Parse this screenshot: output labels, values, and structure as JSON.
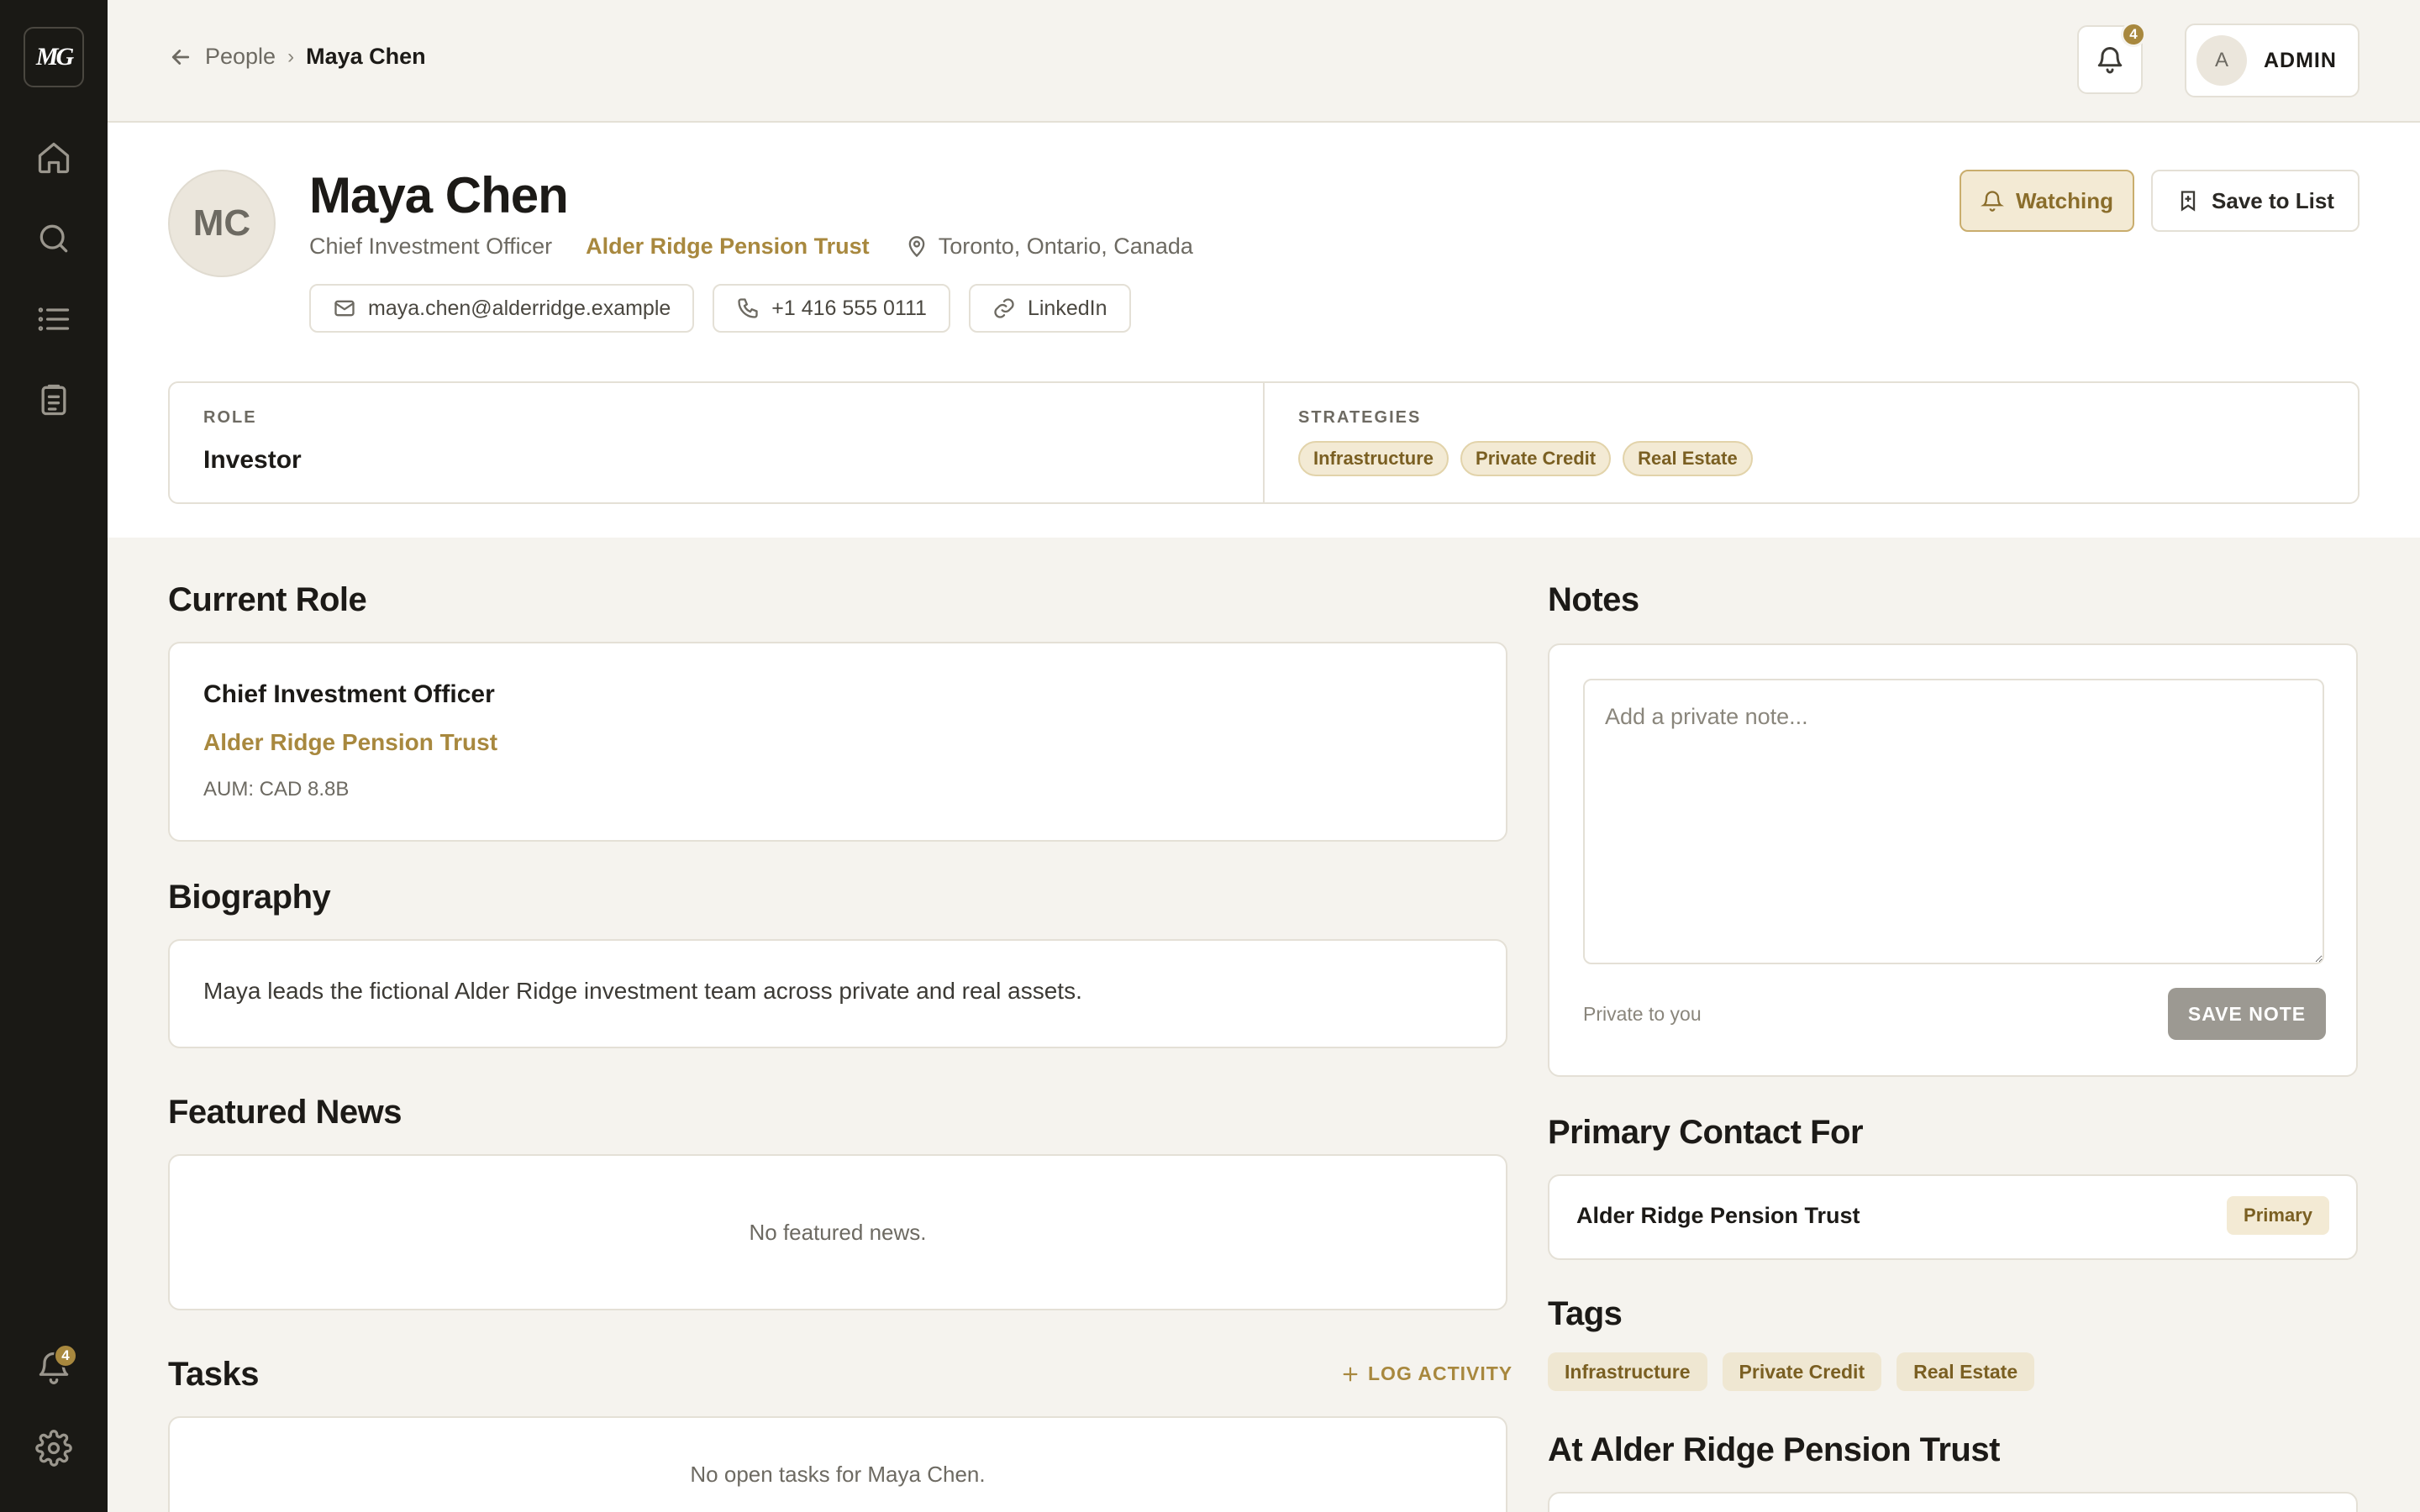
{
  "sidebar": {
    "logo": "MG",
    "items": [
      {
        "icon": "home-icon"
      },
      {
        "icon": "search-icon"
      },
      {
        "icon": "list-icon"
      },
      {
        "icon": "clipboard-icon"
      }
    ],
    "notifications_badge": "4",
    "settings_icon": "gear-icon"
  },
  "topbar": {
    "breadcrumb_parent": "People",
    "breadcrumb_separator": "›",
    "breadcrumb_current": "Maya Chen",
    "notifications_badge": "4",
    "user_initial": "A",
    "user_label": "ADMIN"
  },
  "profile": {
    "initials": "MC",
    "name": "Maya Chen",
    "title": "Chief Investment Officer",
    "organization": "Alder Ridge Pension Trust",
    "location": "Toronto, Ontario, Canada",
    "email": "maya.chen@alderridge.example",
    "phone": "+1 416 555 0111",
    "linkedin": "LinkedIn",
    "watch_label": "Watching",
    "save_label": "Save to List",
    "role_label": "ROLE",
    "role_value": "Investor",
    "strategies_label": "STRATEGIES",
    "strategies": [
      "Infrastructure",
      "Private Credit",
      "Real Estate"
    ]
  },
  "current_role": {
    "heading": "Current Role",
    "title": "Chief Investment Officer",
    "organization": "Alder Ridge Pension Trust",
    "aum": "AUM: CAD 8.8B"
  },
  "biography": {
    "heading": "Biography",
    "text": "Maya leads the fictional Alder Ridge investment team across private and real assets."
  },
  "featured_news": {
    "heading": "Featured News",
    "empty": "No featured news."
  },
  "tasks": {
    "heading": "Tasks",
    "log_label": "LOG ACTIVITY",
    "empty": "No open tasks for Maya Chen."
  },
  "notes": {
    "heading": "Notes",
    "placeholder": "Add a private note...",
    "privacy": "Private to you",
    "save_label": "SAVE NOTE"
  },
  "primary_contact": {
    "heading": "Primary Contact For",
    "organization": "Alder Ridge Pension Trust",
    "badge": "Primary"
  },
  "tags": {
    "heading": "Tags",
    "items": [
      "Infrastructure",
      "Private Credit",
      "Real Estate"
    ]
  },
  "at_org": {
    "heading": "At Alder Ridge Pension Trust"
  },
  "colors": {
    "accent": "#a8883e",
    "sidebar": "#1a1915",
    "background": "#f5f3ee"
  }
}
